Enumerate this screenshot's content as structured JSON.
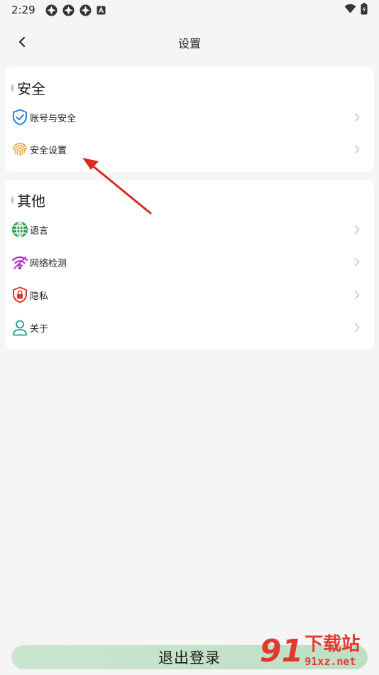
{
  "status_bar": {
    "time": "2:29",
    "notification_icons": [
      "app-icon",
      "app-icon",
      "app-icon",
      "a-badge-icon"
    ],
    "right_icons": [
      "wifi-icon",
      "battery-icon"
    ]
  },
  "header": {
    "title": "设置"
  },
  "sections": [
    {
      "title": "安全",
      "items": [
        {
          "label": "账号与安全",
          "icon": "shield-check-icon"
        },
        {
          "label": "安全设置",
          "icon": "fingerprint-icon"
        }
      ]
    },
    {
      "title": "其他",
      "items": [
        {
          "label": "语言",
          "icon": "globe-icon"
        },
        {
          "label": "网络检测",
          "icon": "wifi-signal-icon"
        },
        {
          "label": "隐私",
          "icon": "lock-shield-icon"
        },
        {
          "label": "关于",
          "icon": "person-icon"
        }
      ]
    }
  ],
  "footer": {
    "logout_label": "退出登录"
  },
  "watermark": {
    "logo": "91",
    "name": "下载站",
    "site": "91xz.net"
  },
  "colors": {
    "accent": "#a4d2ac",
    "logout_bg": "#c6e2cb",
    "annotation_arrow": "#d62b25",
    "watermark": "#e2392f"
  }
}
